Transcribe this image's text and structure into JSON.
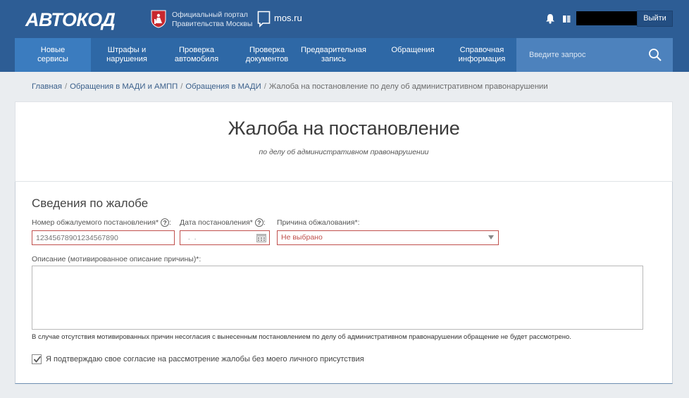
{
  "header": {
    "logo": "АВТОКОД",
    "gov_line1": "Официальный портал",
    "gov_line2": "Правительства Москвы",
    "mos_label": "mos.ru",
    "logout_label": "Выйти"
  },
  "nav": {
    "items": [
      {
        "line1": "Новые",
        "line2": "сервисы"
      },
      {
        "line1": "Штрафы и",
        "line2": "нарушения"
      },
      {
        "line1": "Проверка",
        "line2": "автомобиля"
      },
      {
        "line1": "Проверка",
        "line2": "документов"
      },
      {
        "line1": "Предварительная",
        "line2": "запись"
      },
      {
        "line1": "Обращения",
        "line2": ""
      },
      {
        "line1": "Справочная",
        "line2": "информация"
      }
    ],
    "search_placeholder": "Введите запрос"
  },
  "breadcrumb": {
    "items": [
      "Главная",
      "Обращения в МАДИ и АМПП",
      "Обращения в МАДИ"
    ],
    "separator": "/",
    "current": "Жалоба на постановление по делу об административном правонарушении"
  },
  "page": {
    "title": "Жалоба на постановление",
    "subtitle": "по делу об административном правонарушении"
  },
  "form": {
    "section_title": "Сведения по жалобе",
    "decree_number_label": "Номер обжалуемого постановления",
    "decree_number_placeholder": "12345678901234567890",
    "decree_date_label": "Дата постановления",
    "decree_date_placeholder": "  .  .",
    "reason_label": "Причина обжалования",
    "reason_value": "Не выбрано",
    "description_label": "Описание (мотивированное описание причины)*:",
    "note": "В случае отсутствия мотивированных причин несогласия с вынесенным постановлением по делу об административном правонарушении обращение не будет рассмотрено.",
    "consent_label": "Я подтверждаю свое согласие на рассмотрение жалобы без моего личного присутствия",
    "consent_checked": true,
    "required_mark": "*",
    "help_glyph": "?",
    "label_suffix": ":"
  },
  "colors": {
    "header_bg": "#2d5d95",
    "nav_bg": "#2e68a6",
    "nav_active": "#3b7cbf",
    "search_bg": "#4d82bd",
    "error_border": "#c0504d"
  }
}
